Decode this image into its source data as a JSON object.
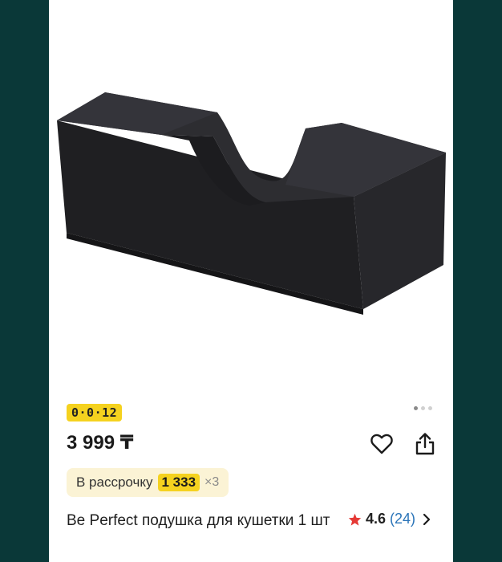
{
  "product": {
    "badge": "0·0·12",
    "price": "3 999 ₸",
    "installment": {
      "label": "В рассрочку",
      "amount": "1 333",
      "multiplier": "×3"
    },
    "title": "Be Perfect подушка для кушетки 1 шт",
    "rating": {
      "value": "4.6",
      "count": "(24)"
    }
  },
  "icons": {
    "favorite": "heart-icon",
    "share": "share-icon",
    "star": "star-icon",
    "chevron": "chevron-right-icon"
  },
  "gallery": {
    "total": 3,
    "active": 1
  },
  "colors": {
    "badge": "#f5d21f",
    "installment_bg": "#fbf3d5",
    "star": "#e53935",
    "link": "#2a74b8",
    "side_bg": "#0a3838"
  }
}
